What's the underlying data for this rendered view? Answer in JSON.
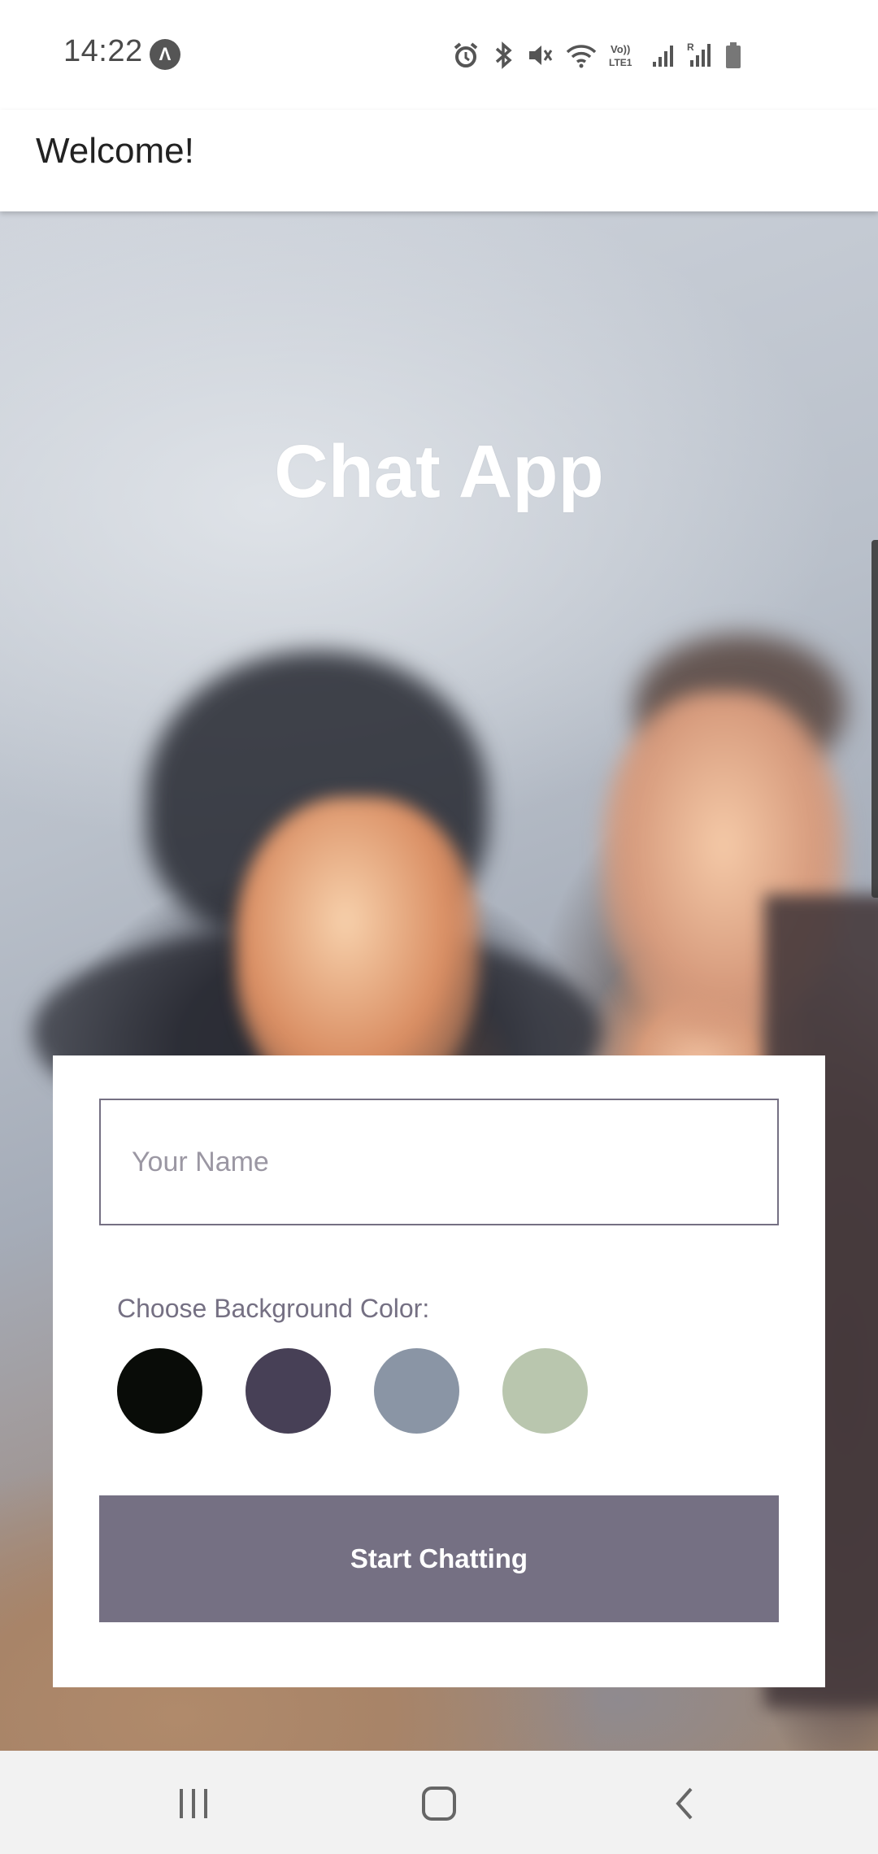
{
  "status_bar": {
    "time": "14:22",
    "app_icon": "arrow-up-icon",
    "icons": [
      "alarm-icon",
      "bluetooth-icon",
      "mute-icon",
      "wifi-icon",
      "volte-icon",
      "signal-icon",
      "signal-roaming-icon",
      "battery-icon"
    ],
    "volte_text": "VoLTE1"
  },
  "app_bar": {
    "title": "Welcome!"
  },
  "hero": {
    "title": "Chat App"
  },
  "form": {
    "name_placeholder": "Your Name",
    "name_value": "",
    "color_label": "Choose Background Color:",
    "colors": [
      "#090C08",
      "#474056",
      "#8A95A5",
      "#B9C6AE"
    ],
    "start_button": "Start Chatting",
    "button_color": "#757083"
  },
  "nav_bar": {
    "buttons": [
      "recents-icon",
      "home-icon",
      "back-icon"
    ]
  }
}
